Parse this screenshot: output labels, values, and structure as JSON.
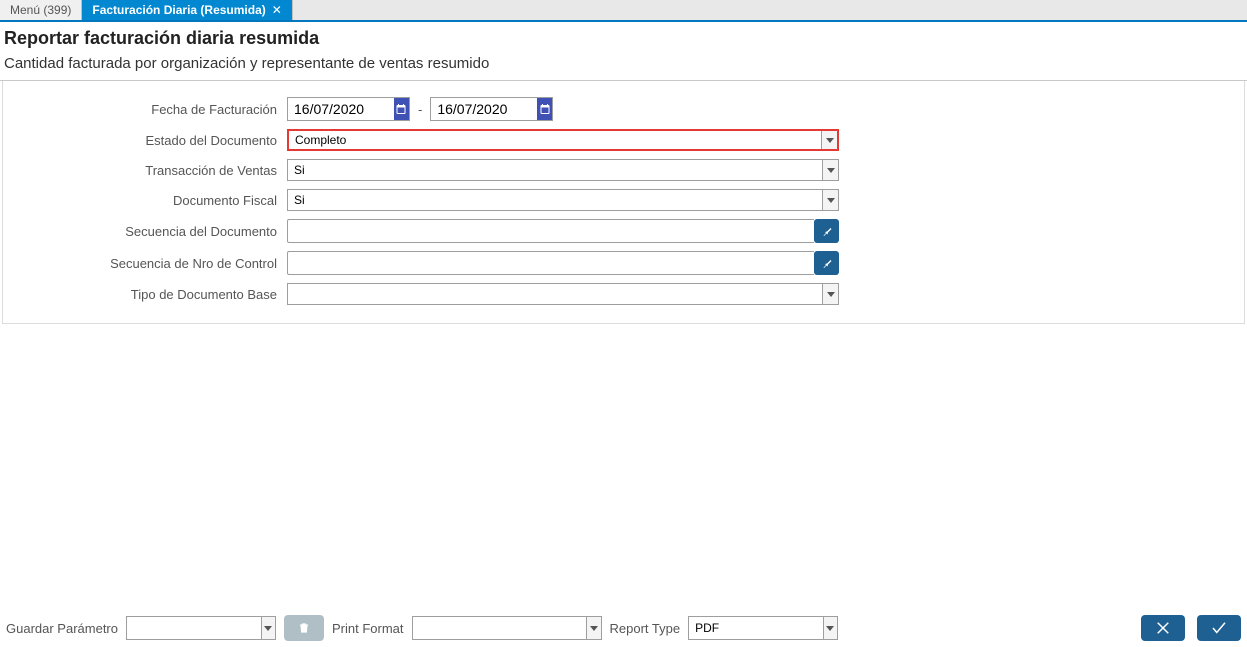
{
  "tabs": {
    "menu": "Menú (399)",
    "active": "Facturación Diaria (Resumida)"
  },
  "header": {
    "title": "Reportar facturación diaria resumida",
    "subtitle": "Cantidad facturada por organización y representante de ventas resumido"
  },
  "form": {
    "fecha_label": "Fecha de Facturación",
    "fecha_from": "16/07/2020",
    "fecha_sep": "-",
    "fecha_to": "16/07/2020",
    "estado_label": "Estado del Documento",
    "estado_value": "Completo",
    "trans_label": "Transacción de Ventas",
    "trans_value": "Si",
    "fiscal_label": "Documento Fiscal",
    "fiscal_value": "Si",
    "seq_label": "Secuencia del Documento",
    "seq_value": "",
    "control_label": "Secuencia de Nro de Control",
    "control_value": "",
    "tipo_label": "Tipo de Documento Base",
    "tipo_value": ""
  },
  "footer": {
    "guardar_label": "Guardar Parámetro",
    "guardar_value": "",
    "print_label": "Print Format",
    "print_value": "",
    "report_label": "Report Type",
    "report_value": "PDF"
  }
}
